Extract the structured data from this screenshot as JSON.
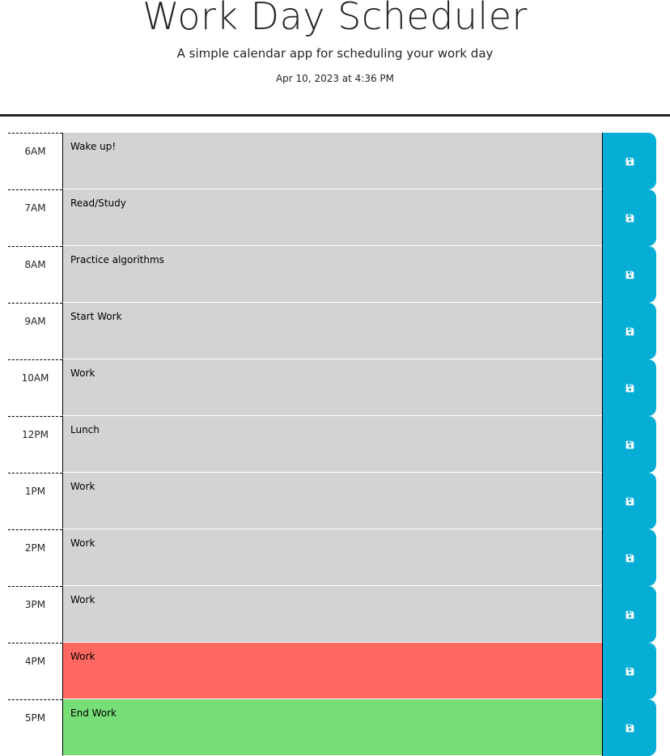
{
  "header": {
    "title": "Work Day Scheduler",
    "subtitle": "A simple calendar app for scheduling your work day",
    "current_date": "Apr 10, 2023 at 4:36 PM"
  },
  "colors": {
    "past": "#d3d3d3",
    "present": "#ff6961",
    "future": "#77dd77",
    "save_button": "#06aed5"
  },
  "rows": [
    {
      "hour": "6AM",
      "text": "Wake up!",
      "state": "past",
      "save_icon": "save-icon"
    },
    {
      "hour": "7AM",
      "text": "Read/Study",
      "state": "past",
      "save_icon": "save-icon"
    },
    {
      "hour": "8AM",
      "text": "Practice algorithms",
      "state": "past",
      "save_icon": "save-icon"
    },
    {
      "hour": "9AM",
      "text": "Start Work",
      "state": "past",
      "save_icon": "save-icon"
    },
    {
      "hour": "10AM",
      "text": "Work",
      "state": "past",
      "save_icon": "save-icon"
    },
    {
      "hour": "12PM",
      "text": "Lunch",
      "state": "past",
      "save_icon": "save-icon"
    },
    {
      "hour": "1PM",
      "text": "Work",
      "state": "past",
      "save_icon": "save-icon"
    },
    {
      "hour": "2PM",
      "text": "Work",
      "state": "past",
      "save_icon": "save-icon"
    },
    {
      "hour": "3PM",
      "text": "Work",
      "state": "past",
      "save_icon": "save-icon"
    },
    {
      "hour": "4PM",
      "text": "Work",
      "state": "present",
      "save_icon": "save-icon"
    },
    {
      "hour": "5PM",
      "text": "End Work",
      "state": "future",
      "save_icon": "save-icon"
    }
  ]
}
